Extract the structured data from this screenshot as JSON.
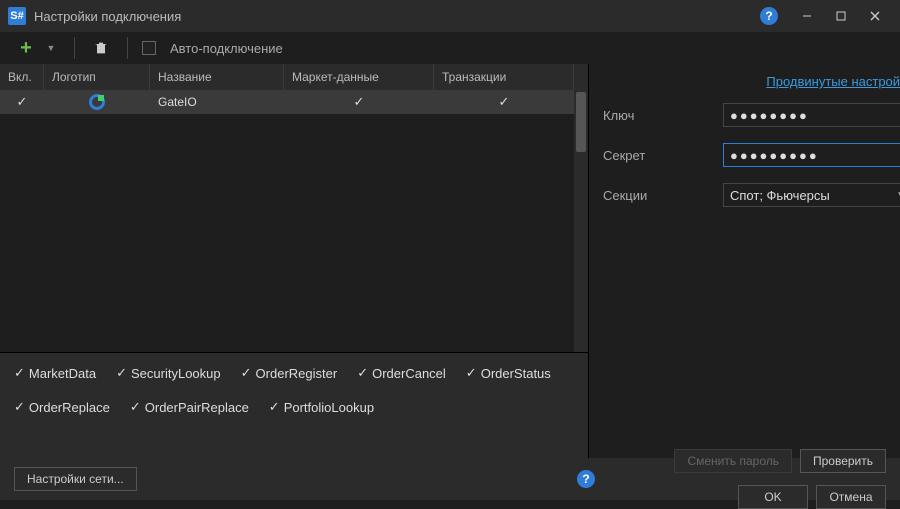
{
  "titlebar": {
    "logo_text": "S#",
    "title": "Настройки подключения"
  },
  "toolbar": {
    "autoconnect_label": "Авто-подключение"
  },
  "grid": {
    "headers": {
      "enabled": "Вкл.",
      "logo": "Логотип",
      "name": "Название",
      "market_data": "Маркет-данные",
      "transactions": "Транзакции"
    },
    "rows": [
      {
        "enabled": "✓",
        "name": "GateIO",
        "market_data": "✓",
        "transactions": "✓"
      }
    ]
  },
  "capabilities": [
    "MarketData",
    "SecurityLookup",
    "OrderRegister",
    "OrderCancel",
    "OrderStatus",
    "OrderReplace",
    "OrderPairReplace",
    "PortfolioLookup"
  ],
  "right_panel": {
    "advanced_link": "Продвинутые настройки",
    "key_label": "Ключ",
    "key_value": "●●●●●●●●",
    "secret_label": "Секрет",
    "secret_value": "●●●●●●●●●",
    "sections_label": "Секции",
    "sections_value": "Спот; Фьючерсы"
  },
  "footer": {
    "network_settings": "Настройки сети...",
    "change_password": "Сменить пароль",
    "verify": "Проверить",
    "ok": "OK",
    "cancel": "Отмена"
  }
}
